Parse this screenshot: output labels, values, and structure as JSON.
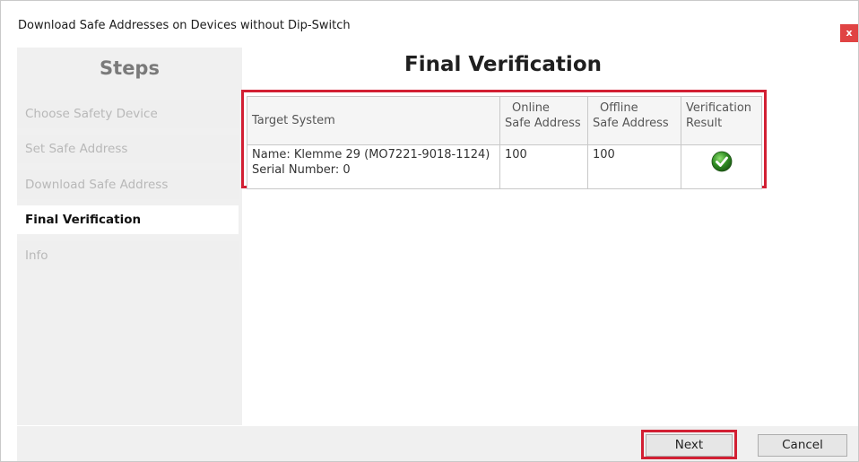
{
  "window": {
    "title": "Download Safe Addresses on Devices without Dip-Switch",
    "close_label": "x"
  },
  "steps": {
    "header": "Steps",
    "items": [
      {
        "label": "Choose Safety Device",
        "state": "done"
      },
      {
        "label": "Set Safe Address",
        "state": "done"
      },
      {
        "label": "Download Safe Address",
        "state": "done"
      },
      {
        "label": "Final Verification",
        "state": "active"
      },
      {
        "label": "Info",
        "state": "pending"
      }
    ]
  },
  "main": {
    "title": "Final Verification",
    "table": {
      "headers": {
        "target_system": "Target System",
        "online_l1": "Online",
        "online_l2": "Safe Address",
        "offline_l1": "Offline",
        "offline_l2": "Safe Address",
        "result_l1": "Verification",
        "result_l2": "Result"
      },
      "rows": [
        {
          "name": "Name: Klemme 29 (MO7221-9018-1124)",
          "serial": "Serial Number: 0",
          "online": "100",
          "offline": "100",
          "result_icon": "check-circle-icon"
        }
      ]
    }
  },
  "buttons": {
    "next": "Next",
    "cancel": "Cancel"
  },
  "colors": {
    "highlight": "#d21f33",
    "check": "#2e8b22",
    "close": "#e04343"
  }
}
